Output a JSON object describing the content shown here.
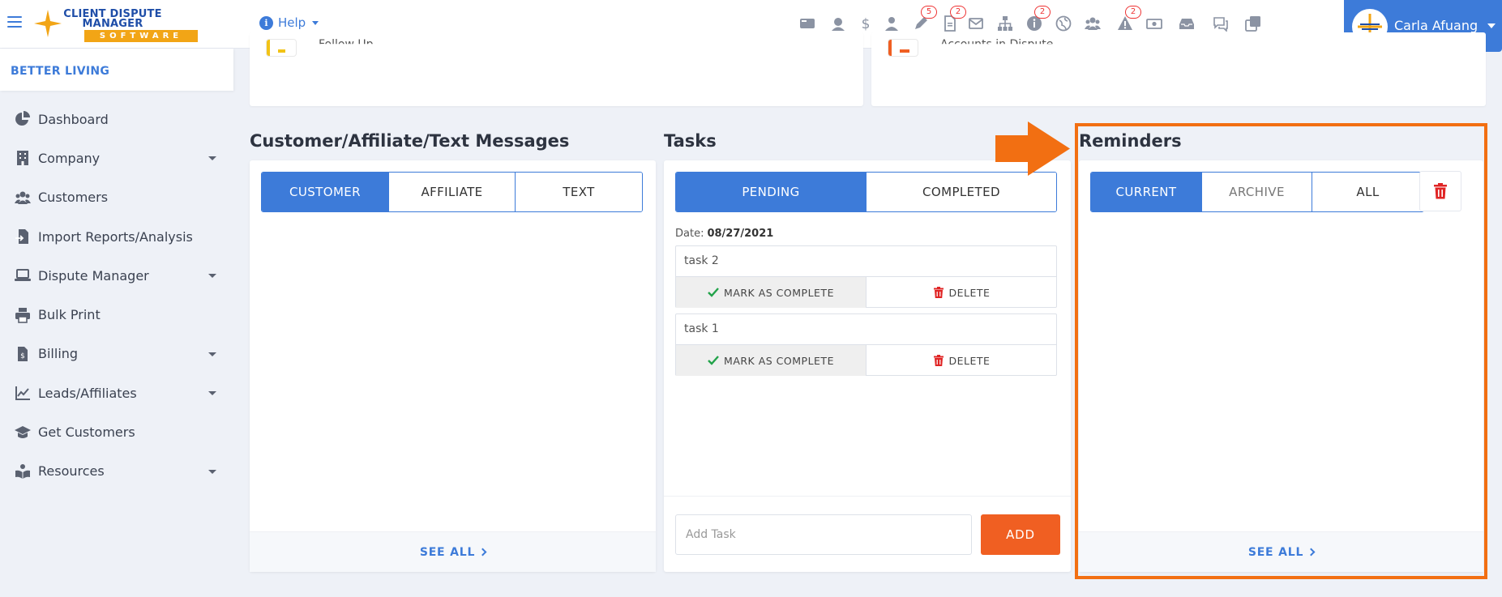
{
  "app": {
    "logo": {
      "line1": "CLIENT DISPUTE",
      "line2": "MANAGER",
      "line3": "SOFTWARE"
    },
    "help_label": "Help"
  },
  "toolbar": {
    "icons": [
      {
        "name": "id-card-icon",
        "badge": ""
      },
      {
        "name": "support-agent-icon",
        "badge": ""
      },
      {
        "name": "dollar-icon",
        "badge": ""
      },
      {
        "name": "user-tie-icon",
        "badge": ""
      },
      {
        "name": "pen-icon",
        "badge": "5"
      },
      {
        "name": "document-icon",
        "badge": "2"
      },
      {
        "name": "envelope-icon",
        "badge": ""
      },
      {
        "name": "sitemap-icon",
        "badge": ""
      },
      {
        "name": "info-icon",
        "badge": "2"
      },
      {
        "name": "globe-icon",
        "badge": ""
      },
      {
        "name": "users-icon",
        "badge": ""
      },
      {
        "name": "warning-icon",
        "badge": "2"
      },
      {
        "name": "money-bill-icon",
        "badge": ""
      },
      {
        "name": "inbox-icon",
        "badge": ""
      },
      {
        "name": "chat-icon",
        "badge": ""
      },
      {
        "name": "copy-icon",
        "badge": ""
      }
    ]
  },
  "user": {
    "name": "Carla Afuang"
  },
  "sidebar": {
    "company": "BETTER LIVING",
    "items": [
      {
        "label": "Dashboard",
        "icon": "pie-chart-icon",
        "has_caret": false
      },
      {
        "label": "Company",
        "icon": "building-icon",
        "has_caret": true
      },
      {
        "label": "Customers",
        "icon": "users-icon",
        "has_caret": false
      },
      {
        "label": "Import Reports/Analysis",
        "icon": "file-import-icon",
        "has_caret": false
      },
      {
        "label": "Dispute Manager",
        "icon": "laptop-icon",
        "has_caret": true
      },
      {
        "label": "Bulk Print",
        "icon": "printer-icon",
        "has_caret": false
      },
      {
        "label": "Billing",
        "icon": "invoice-icon",
        "has_caret": true
      },
      {
        "label": "Leads/Affiliates",
        "icon": "line-chart-icon",
        "has_caret": true
      },
      {
        "label": "Get Customers",
        "icon": "graduation-cap-icon",
        "has_caret": false
      },
      {
        "label": "Resources",
        "icon": "book-reader-icon",
        "has_caret": true
      }
    ]
  },
  "top_cards": {
    "left_text": "Follow Up",
    "right_text": "Accounts in Dispute"
  },
  "messages": {
    "title": "Customer/Affiliate/Text Messages",
    "tabs": [
      "CUSTOMER",
      "AFFILIATE",
      "TEXT"
    ],
    "active_tab": 0,
    "see_all": "SEE ALL"
  },
  "tasks": {
    "title": "Tasks",
    "tabs": [
      "PENDING",
      "COMPLETED"
    ],
    "active_tab": 0,
    "date_label": "Date:",
    "date_value": "08/27/2021",
    "items": [
      {
        "name": "task 2"
      },
      {
        "name": "task 1"
      }
    ],
    "mark_complete_label": "MARK AS COMPLETE",
    "delete_label": "DELETE",
    "input_placeholder": "Add Task",
    "add_label": "ADD"
  },
  "reminders": {
    "title": "Reminders",
    "tabs": [
      "CURRENT",
      "ARCHIVE",
      "ALL"
    ],
    "active_tab": 0,
    "see_all": "SEE ALL"
  },
  "colors": {
    "primary": "#3d7bd9",
    "accent_orange": "#f05f22",
    "highlight": "#f26f12",
    "danger": "#e02424",
    "success": "#22a34a"
  }
}
